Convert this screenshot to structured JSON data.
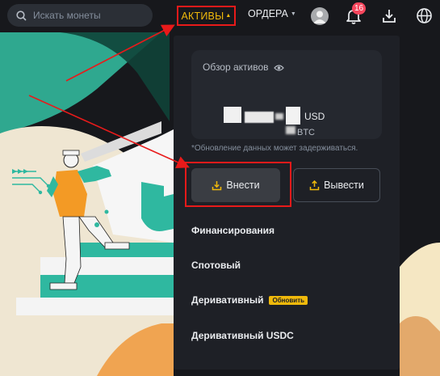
{
  "search": {
    "placeholder": "Искать монеты"
  },
  "nav": {
    "assets_label": "АКТИВЫ",
    "orders_label": "ОРДЕРА",
    "notification_count": "16"
  },
  "panel": {
    "overview_title": "Обзор активов",
    "usd_unit": "USD",
    "btc_unit": "BTC",
    "update_note": "*Обновление данных может задерживаться.",
    "deposit_label": "Внести",
    "withdraw_label": "Вывести",
    "menu": [
      {
        "label": "Финансирования"
      },
      {
        "label": "Спотовый"
      },
      {
        "label": "Деривативный",
        "tag": "Обновить"
      },
      {
        "label": "Деривативный USDC"
      }
    ]
  },
  "colors": {
    "accent": "#f0b90b",
    "highlight": "#e81a1a",
    "badge": "#f6465d",
    "panel_bg": "#1e2026",
    "teal": "#2fb8a0"
  },
  "icons": [
    "search-icon",
    "caret-down-icon",
    "avatar-icon",
    "bell-icon",
    "download-icon",
    "globe-icon",
    "eye-icon",
    "deposit-icon",
    "withdraw-icon"
  ]
}
